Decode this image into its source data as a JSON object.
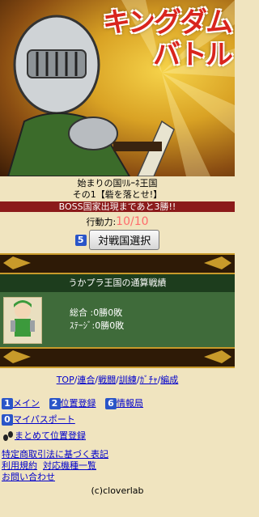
{
  "banner": {
    "title": "キングダム\nバトル"
  },
  "stage": {
    "line1": "始まりの国ﾘﾙｰﾈ王国",
    "line2": "その1【砦を落とせ!】"
  },
  "boss_notice": "BOSS国家出現まであと3勝!!",
  "action": {
    "label": "行動力:",
    "value": "10/10"
  },
  "select": {
    "badge": "5",
    "label": "対戦国選択"
  },
  "record": {
    "header": "うかプラ王国の通算戦績",
    "total": "総合 :0勝0敗",
    "stage": "ｽﾃｰｼﾞ:0勝0敗"
  },
  "quick_links": [
    "TOP",
    "連合",
    "戦闘",
    "訓練",
    "ｶﾞﾁｬ",
    "編成"
  ],
  "nav": {
    "main_badge": "1",
    "main": "メイン",
    "position_badge": "2",
    "position": "位置登録",
    "info_badge": "6",
    "info": "情報局",
    "passport_badge": "0",
    "passport": "マイパスポート",
    "bulk": "まとめて位置登録"
  },
  "footer": {
    "law": "特定商取引法に基づく表記",
    "terms": "利用規約",
    "devices": "対応機種一覧",
    "contact": "お問い合わせ",
    "copyright": "(c)cloverlab"
  },
  "colors": {
    "background": "#f0e4bf",
    "boss_bar": "#8b1a1a",
    "panel_green": "#3f6b3a",
    "link": "#0000cc",
    "badge_blue": "#2a55c8"
  }
}
